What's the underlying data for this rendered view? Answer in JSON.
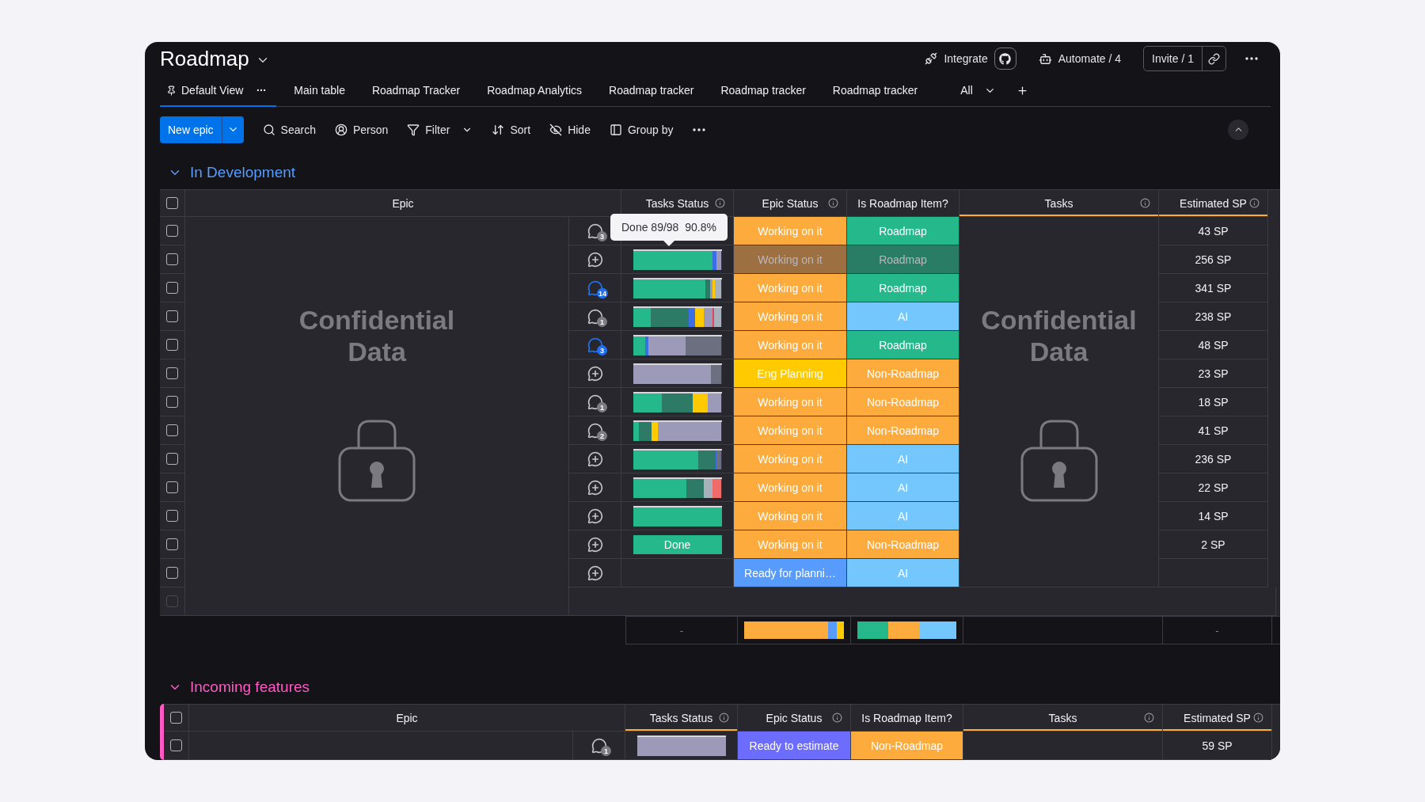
{
  "board": {
    "title": "Roadmap"
  },
  "header_actions": {
    "integrate": "Integrate",
    "automate": "Automate / 4",
    "invite": "Invite / 1"
  },
  "tabs": [
    {
      "label": "Default View",
      "selected": true,
      "pinned": true
    },
    {
      "label": "Main table",
      "selected": false,
      "pinned": false
    },
    {
      "label": "Roadmap Tracker",
      "selected": false,
      "pinned": false
    },
    {
      "label": "Roadmap Analytics",
      "selected": false,
      "pinned": false
    },
    {
      "label": "Roadmap tracker",
      "selected": false,
      "pinned": false
    },
    {
      "label": "Roadmap tracker",
      "selected": false,
      "pinned": false
    },
    {
      "label": "Roadmap tracker",
      "selected": false,
      "pinned": false
    }
  ],
  "tabs_more": "All",
  "toolbar": {
    "new_button": "New epic",
    "items": [
      {
        "kind": "search",
        "label": "Search"
      },
      {
        "kind": "person",
        "label": "Person"
      },
      {
        "kind": "filter",
        "label": "Filter"
      },
      {
        "kind": "sort",
        "label": "Sort"
      },
      {
        "kind": "hide",
        "label": "Hide"
      },
      {
        "kind": "group",
        "label": "Group by"
      }
    ]
  },
  "groups": [
    {
      "title": "In Development",
      "color": "#579bfc",
      "all_checked": false,
      "epic_area": {
        "text": "Confidential Data"
      },
      "tasks_area": {
        "text": "Confidential Data"
      },
      "add_row": {
        "disabled": true
      },
      "columns": [
        {
          "label": "Epic",
          "info": false,
          "underlined": false
        },
        {
          "label": "Tasks Status",
          "info": true,
          "underlined": false
        },
        {
          "label": "Epic Status",
          "info": true,
          "underlined": false
        },
        {
          "label": "Is Roadmap Item?",
          "info": false,
          "underlined": false
        },
        {
          "label": "Tasks",
          "info": true,
          "underlined": true
        },
        {
          "label": "Estimated SP",
          "info": true,
          "underlined": true
        }
      ],
      "rows": [
        {
          "checked": false,
          "dimmed": false,
          "comments": {
            "kind": "count",
            "count": "3",
            "unread": false
          },
          "tasks_status": {
            "kind": "tooltip",
            "text": "Done 89/98  90.8%"
          },
          "epic_status": {
            "label": "Working on it",
            "color": "#fdab3d"
          },
          "roadmap": {
            "label": "Roadmap",
            "color": "#25b88a"
          },
          "estimated_sp": "43 SP"
        },
        {
          "checked": false,
          "dimmed": true,
          "comments": {
            "kind": "add"
          },
          "tasks_status": {
            "kind": "bar"
          },
          "epic_status": {
            "label": "Working on it",
            "color": "#9c7040"
          },
          "roadmap": {
            "label": "Roadmap",
            "color": "#2a7d65"
          },
          "estimated_sp": "256 SP"
        },
        {
          "checked": false,
          "dimmed": false,
          "comments": {
            "kind": "count",
            "count": "14",
            "unread": true
          },
          "tasks_status": {
            "kind": "bar"
          },
          "epic_status": {
            "label": "Working on it",
            "color": "#fdab3d"
          },
          "roadmap": {
            "label": "Roadmap",
            "color": "#25b88a"
          },
          "estimated_sp": "341 SP"
        },
        {
          "checked": false,
          "dimmed": false,
          "comments": {
            "kind": "count",
            "count": "1",
            "unread": false
          },
          "tasks_status": {
            "kind": "bar"
          },
          "epic_status": {
            "label": "Working on it",
            "color": "#fdab3d"
          },
          "roadmap": {
            "label": "AI",
            "color": "#74c7fc"
          },
          "estimated_sp": "238 SP"
        },
        {
          "checked": false,
          "dimmed": false,
          "comments": {
            "kind": "count",
            "count": "3",
            "unread": true
          },
          "tasks_status": {
            "kind": "bar"
          },
          "epic_status": {
            "label": "Working on it",
            "color": "#fdab3d"
          },
          "roadmap": {
            "label": "Roadmap",
            "color": "#25b88a"
          },
          "estimated_sp": "48 SP"
        },
        {
          "checked": false,
          "dimmed": false,
          "comments": {
            "kind": "add"
          },
          "tasks_status": {
            "kind": "bar"
          },
          "epic_status": {
            "label": "Eng Planning",
            "color": "#ffcb00"
          },
          "roadmap": {
            "label": "Non-Roadmap",
            "color": "#fdab3d"
          },
          "estimated_sp": "23 SP"
        },
        {
          "checked": false,
          "dimmed": false,
          "comments": {
            "kind": "count",
            "count": "1",
            "unread": false
          },
          "tasks_status": {
            "kind": "bar"
          },
          "epic_status": {
            "label": "Working on it",
            "color": "#fdab3d"
          },
          "roadmap": {
            "label": "Non-Roadmap",
            "color": "#fdab3d"
          },
          "estimated_sp": "18 SP"
        },
        {
          "checked": false,
          "dimmed": false,
          "comments": {
            "kind": "count",
            "count": "2",
            "unread": false
          },
          "tasks_status": {
            "kind": "bar"
          },
          "epic_status": {
            "label": "Working on it",
            "color": "#fdab3d"
          },
          "roadmap": {
            "label": "Non-Roadmap",
            "color": "#fdab3d"
          },
          "estimated_sp": "41 SP"
        },
        {
          "checked": false,
          "dimmed": false,
          "comments": {
            "kind": "add"
          },
          "tasks_status": {
            "kind": "bar"
          },
          "epic_status": {
            "label": "Working on it",
            "color": "#fdab3d"
          },
          "roadmap": {
            "label": "AI",
            "color": "#74c7fc"
          },
          "estimated_sp": "236 SP"
        },
        {
          "checked": false,
          "dimmed": false,
          "comments": {
            "kind": "add"
          },
          "tasks_status": {
            "kind": "bar"
          },
          "epic_status": {
            "label": "Working on it",
            "color": "#fdab3d"
          },
          "roadmap": {
            "label": "AI",
            "color": "#74c7fc"
          },
          "estimated_sp": "22 SP"
        },
        {
          "checked": false,
          "dimmed": false,
          "comments": {
            "kind": "add"
          },
          "tasks_status": {
            "kind": "bar"
          },
          "epic_status": {
            "label": "Working on it",
            "color": "#fdab3d"
          },
          "roadmap": {
            "label": "AI",
            "color": "#74c7fc"
          },
          "estimated_sp": "14 SP"
        },
        {
          "checked": false,
          "dimmed": false,
          "comments": {
            "kind": "add"
          },
          "tasks_status": {
            "kind": "label",
            "label": "Done",
            "color": "#25b88a"
          },
          "epic_status": {
            "label": "Working on it",
            "color": "#fdab3d"
          },
          "roadmap": {
            "label": "Non-Roadmap",
            "color": "#fdab3d"
          },
          "estimated_sp": "2 SP"
        },
        {
          "checked": false,
          "dimmed": false,
          "comments": {
            "kind": "add"
          },
          "epic_status": {
            "label": "Ready for planni…",
            "color": "#579bfc"
          },
          "roadmap": {
            "label": "AI",
            "color": "#74c7fc"
          }
        }
      ],
      "footer": {
        "tasks_status": "-",
        "estimated_sp": "-"
      }
    },
    {
      "title": "Incoming features",
      "color": "#ff5ac4",
      "all_checked": false,
      "columns": [
        {
          "label": "Epic",
          "info": false,
          "underlined": false
        },
        {
          "label": "Tasks Status",
          "info": true,
          "underlined": true
        },
        {
          "label": "Epic Status",
          "info": true,
          "underlined": false
        },
        {
          "label": "Is Roadmap Item?",
          "info": false,
          "underlined": false
        },
        {
          "label": "Tasks",
          "info": true,
          "underlined": true
        },
        {
          "label": "Estimated SP",
          "info": true,
          "underlined": true
        }
      ],
      "rows": [
        {
          "checked": false,
          "dimmed": false,
          "comments": {
            "kind": "count",
            "count": "1",
            "unread": false
          },
          "tasks_status": {
            "kind": "bar"
          },
          "epic_status": {
            "label": "Ready to estimate",
            "color": "#6c6cff"
          },
          "roadmap": {
            "label": "Non-Roadmap",
            "color": "#fdab3d"
          },
          "estimated_sp": "59 SP"
        }
      ]
    }
  ]
}
